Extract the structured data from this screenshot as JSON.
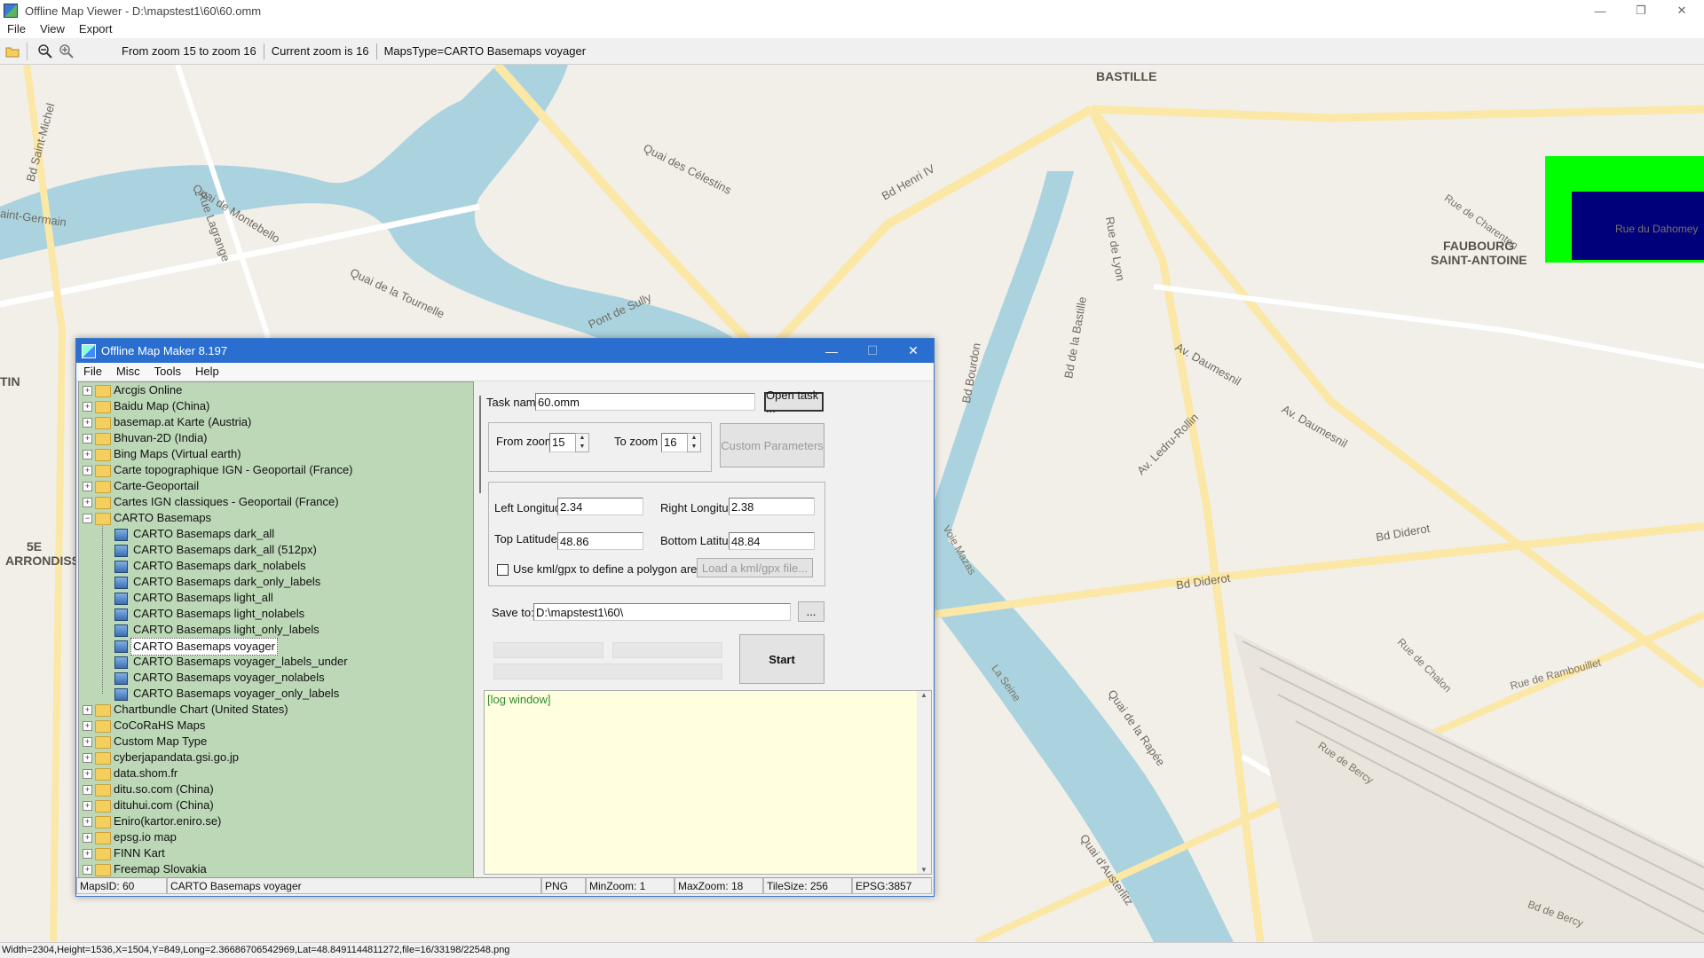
{
  "window": {
    "title": "Offline Map Viewer - D:\\mapstest1\\60\\60.omm",
    "minimize": "—",
    "maximize": "❐",
    "close": "✕"
  },
  "menu": [
    "File",
    "View",
    "Export"
  ],
  "toolbar": {
    "zoom_range": "From zoom 15 to zoom 16",
    "current_zoom": "Current zoom is 16",
    "maps_type": "MapsType=CARTO Basemaps voyager",
    "icons": [
      "open-folder-icon",
      "zoom-out-icon",
      "zoom-in-icon"
    ]
  },
  "map_labels": {
    "bastille": "BASTILLE",
    "faubourg1": "FAUBOURG",
    "faubourg2": "SAINT-ANTOINE",
    "arr1": "5E",
    "arr2": "ARRONDISS",
    "tin": "TIN",
    "quai_celestins": "Quai des Célestins",
    "quai_montebello": "Quai de Montebello",
    "quai_tournelle": "Quai de la Tournelle",
    "bd_henri": "Bd Henri IV",
    "pont_sully": "Pont de Sully",
    "rue_lagrange": "Rue Lagrange",
    "bd_st_michel": "Bd Saint-Michel",
    "st_germain": "aint-Germain",
    "av_daumesnil": "Av. Daumesnil",
    "av_daumesnil2": "Av. Daumesnil",
    "av_ledru": "Av. Ledru-Rollin",
    "bd_diderot": "Bd Diderot",
    "bd_diderot2": "Bd Diderot",
    "rue_lyon": "Rue de Lyon",
    "bd_bastille": "Bd de la Bastille",
    "bd_bourdon": "Bd Bourdon",
    "quai_rapee": "Quai de la Rapée",
    "quai_austerlitz": "Quai d'Austerlitz",
    "la_seine": "La Seine",
    "rue_bercy": "Rue de Bercy",
    "bd_bercy": "Bd de Bercy",
    "rue_chalon": "Rue de Chalon",
    "rue_rambouillet": "Rue de Rambouillet",
    "voie_mazas": "Voie Mazas",
    "rue_charenton": "Rue de Charenton",
    "rue_dahomey": "Rue du Dahomey"
  },
  "status_bar": "Width=2304,Height=1536,X=1504,Y=849,Long=2.36686706542969,Lat=48.8491144811272,file=16/33198/22548.png",
  "dialog": {
    "title": "Offline Map Maker 8.197",
    "minimize": "—",
    "maximize": "☐",
    "close": "✕",
    "menu": [
      "File",
      "Misc",
      "Tools",
      "Help"
    ],
    "tree": {
      "top_items": [
        "Arcgis Online",
        "Baidu Map (China)",
        "basemap.at Karte (Austria)",
        "Bhuvan-2D (India)",
        "Bing Maps (Virtual earth)",
        "Carte topographique IGN - Geoportail (France)",
        "Carte-Geoportail",
        "Cartes IGN classiques - Geoportail (France)"
      ],
      "expanded": "CARTO Basemaps",
      "children": [
        "CARTO Basemaps dark_all",
        "CARTO Basemaps dark_all (512px)",
        "CARTO Basemaps dark_nolabels",
        "CARTO Basemaps dark_only_labels",
        "CARTO Basemaps light_all",
        "CARTO Basemaps light_nolabels",
        "CARTO Basemaps light_only_labels",
        "CARTO Basemaps voyager",
        "CARTO Basemaps voyager_labels_under",
        "CARTO Basemaps voyager_nolabels",
        "CARTO Basemaps voyager_only_labels"
      ],
      "selected_child_index": 7,
      "bottom_items": [
        "Chartbundle Chart (United States)",
        "CoCoRaHS Maps",
        "Custom Map Type",
        "cyberjapandata.gsi.go.jp",
        "data.shom.fr",
        "ditu.so.com (China)",
        "dituhui.com (China)",
        "Eniro(kartor.eniro.se)",
        "epsg.io map",
        "FINN Kart",
        "Freemap Slovakia"
      ]
    },
    "form": {
      "task_name_label": "Task name",
      "task_name_value": "60.omm",
      "open_task": "Open task ...",
      "from_zoom_label": "From zoom",
      "from_zoom_value": "15",
      "to_zoom_label": "To zoom",
      "to_zoom_value": "16",
      "custom_params": "Custom Parameters",
      "left_lon_label": "Left Longitude",
      "left_lon_value": "2.34",
      "right_lon_label": "Right Longitude",
      "right_lon_value": "2.38",
      "top_lat_label": "Top Latitude",
      "top_lat_value": "48.86",
      "bottom_lat_label": "Bottom Latitude",
      "bottom_lat_value": "48.84",
      "kml_label": "Use kml/gpx to define a polygon area",
      "load_kml": "Load a kml/gpx file...",
      "save_to_label": "Save to:",
      "save_to_value": "D:\\mapstest1\\60\\",
      "browse": "...",
      "start": "Start",
      "log": "[log window]"
    },
    "status": {
      "maps_id": "MapsID: 60",
      "map_name": "CARTO Basemaps voyager",
      "format": "PNG",
      "min_zoom": "MinZoom: 1",
      "max_zoom": "MaxZoom: 18",
      "tile_size": "TileSize: 256",
      "epsg": "EPSG:3857"
    }
  },
  "colors": {
    "map_bg": "#f2efe9",
    "water": "#aad3df",
    "major_road": "#fbe7a6",
    "dialog_title": "#2a6fd0",
    "tree_bg": "#bcd8b6",
    "log_bg": "#ffffe0",
    "overlay_green": "#00ff00",
    "overlay_navy": "#00007a"
  }
}
